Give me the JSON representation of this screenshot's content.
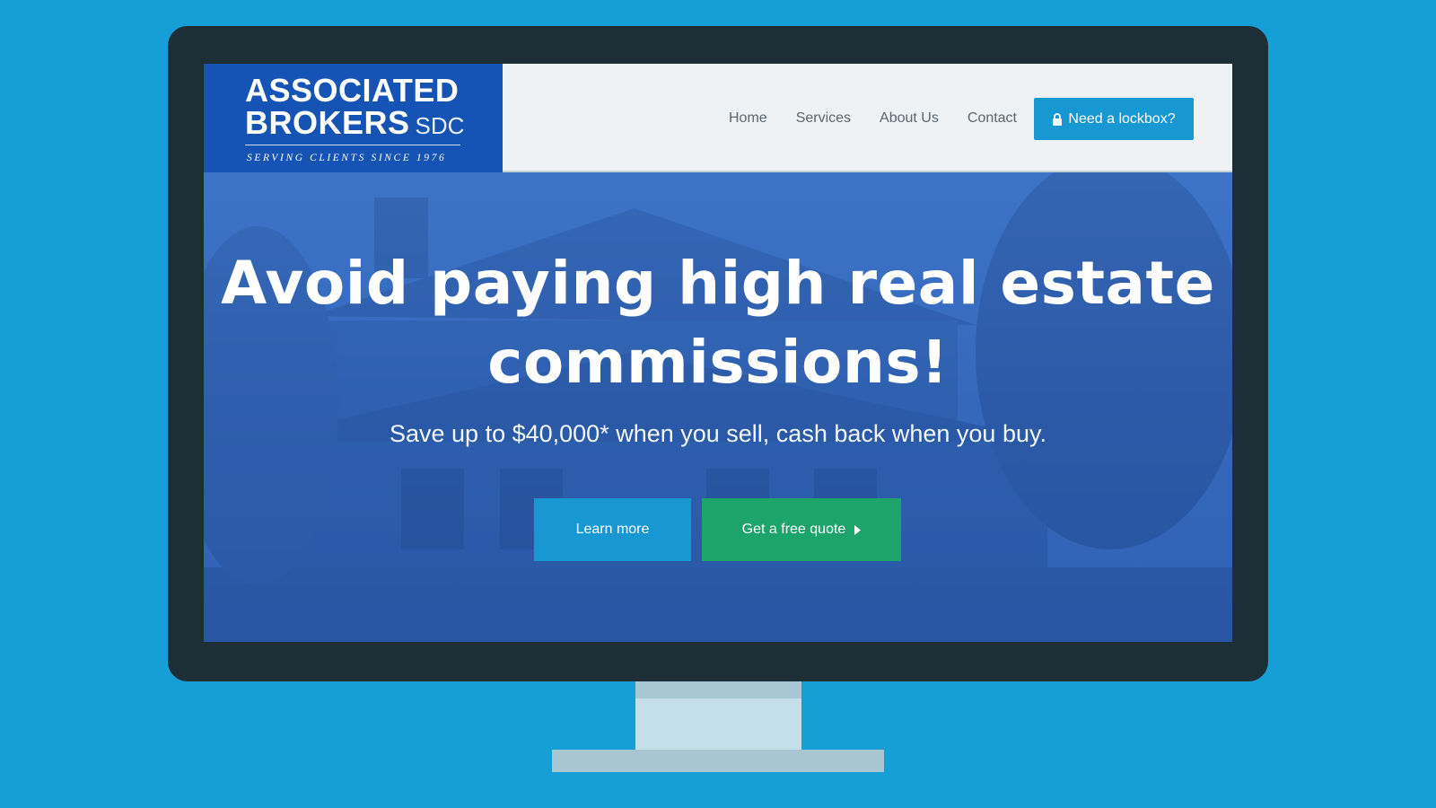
{
  "logo": {
    "line1": "ASSOCIATED",
    "line2": "BROKERS",
    "suffix": "SDC",
    "tagline": "SERVING CLIENTS SINCE 1976"
  },
  "nav": {
    "items": [
      {
        "label": "Home"
      },
      {
        "label": "Services"
      },
      {
        "label": "About Us"
      },
      {
        "label": "Contact"
      }
    ],
    "cta_label": "Need a lockbox?"
  },
  "hero": {
    "title": "Avoid paying high real estate commissions!",
    "subtitle": "Save up to $40,000* when you sell, cash back when you buy.",
    "learn_more_label": "Learn more",
    "quote_label": "Get a free quote"
  },
  "icons": {
    "lock": "lock-icon",
    "caret": "caret-right-icon"
  },
  "colors": {
    "page_bg": "#169ed6",
    "logo_bg": "#1553b4",
    "primary_button": "#1898d3",
    "quote_button": "#1ca46b",
    "hero_overlay": "#2f62b6"
  }
}
